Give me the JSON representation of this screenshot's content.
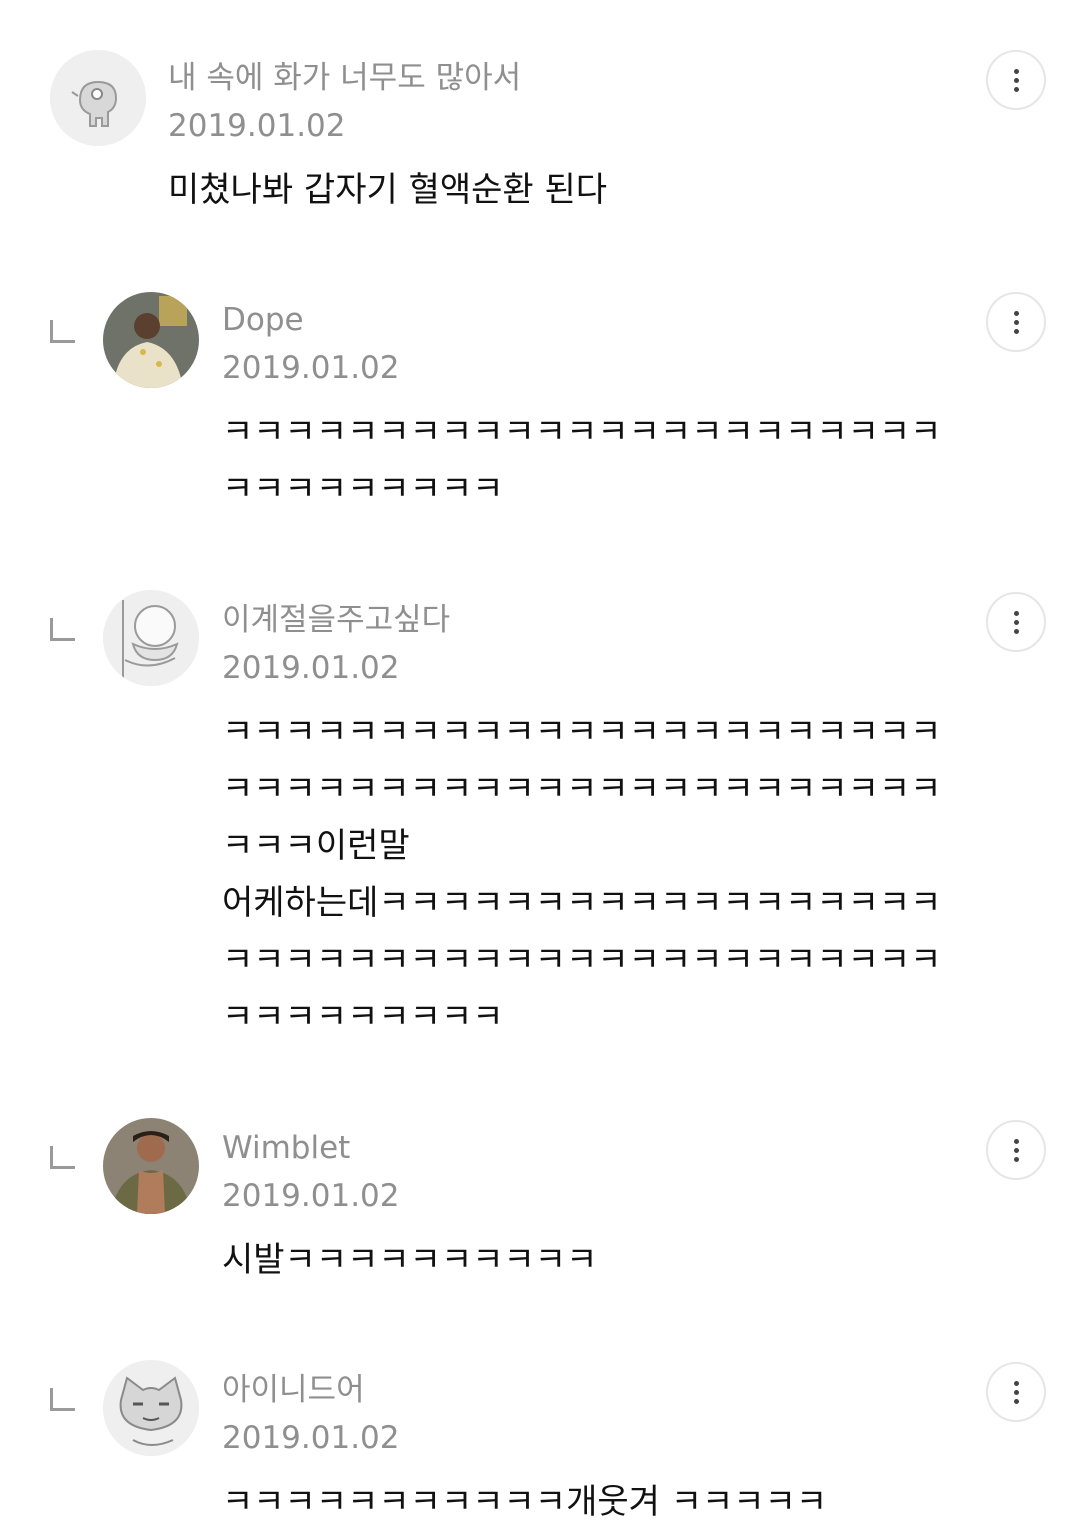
{
  "comments": [
    {
      "author": "내 속에 화가 너무도 많아서",
      "date": "2019.01.02",
      "lines": [
        "미쳤나봐 갑자기 혈액순환 된다"
      ],
      "avatar_icon": "cartoon-creature-avatar"
    },
    {
      "author": "Dope",
      "date": "2019.01.02",
      "lines": [
        "ㅋㅋㅋㅋㅋㅋㅋㅋㅋㅋㅋㅋㅋㅋㅋㅋㅋㅋㅋㅋㅋㅋㅋ",
        "ㅋㅋㅋㅋㅋㅋㅋㅋㅋ"
      ],
      "avatar_icon": "person-photo-avatar"
    },
    {
      "author": "이계절을주고싶다",
      "date": "2019.01.02",
      "lines": [
        "ㅋㅋㅋㅋㅋㅋㅋㅋㅋㅋㅋㅋㅋㅋㅋㅋㅋㅋㅋㅋㅋㅋㅋ",
        "ㅋㅋㅋㅋㅋㅋㅋㅋㅋㅋㅋㅋㅋㅋㅋㅋㅋㅋㅋㅋㅋㅋㅋ",
        "ㅋㅋㅋ이런말",
        "어케하는데ㅋㅋㅋㅋㅋㅋㅋㅋㅋㅋㅋㅋㅋㅋㅋㅋㅋㅋ",
        "ㅋㅋㅋㅋㅋㅋㅋㅋㅋㅋㅋㅋㅋㅋㅋㅋㅋㅋㅋㅋㅋㅋㅋ",
        "ㅋㅋㅋㅋㅋㅋㅋㅋㅋ"
      ],
      "avatar_icon": "cartoon-duck-avatar"
    },
    {
      "author": "Wimblet",
      "date": "2019.01.02",
      "lines": [
        "시발ㅋㅋㅋㅋㅋㅋㅋㅋㅋㅋ"
      ],
      "avatar_icon": "person-photo-avatar"
    },
    {
      "author": "아이니드어",
      "date": "2019.01.02",
      "lines": [
        "ㅋㅋㅋㅋㅋㅋㅋㅋㅋㅋㅋ개웃겨 ㅋㅋㅋㅋㅋ"
      ],
      "avatar_icon": "cartoon-cat-avatar"
    }
  ]
}
